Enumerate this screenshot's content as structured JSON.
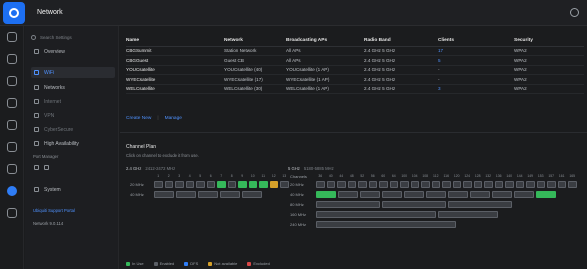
{
  "app": {
    "title": "Network"
  },
  "sidebar": {
    "search_placeholder": "Search Settings",
    "items": [
      {
        "label": "Overview"
      },
      {
        "label": "WiFi"
      },
      {
        "label": "Networks"
      },
      {
        "label": "Internet"
      },
      {
        "label": "VPN"
      },
      {
        "label": "CyberSecure"
      },
      {
        "label": "High Availability"
      }
    ],
    "section_head": "Port Manager",
    "system_label": "System",
    "support_link": "Ubiquiti Support Portal",
    "footer": "Network 9.0.114"
  },
  "table": {
    "columns": [
      "Name",
      "Network",
      "Broadcasting APs",
      "Radio Band",
      "Clients",
      "Security"
    ],
    "rows": [
      {
        "name": "CBGSummit",
        "network": "Station Network",
        "aps": "All APs",
        "band": "2.4 GHz  5 GHz",
        "clients": "17",
        "security": "WPA2"
      },
      {
        "name": "CBGGuest",
        "network": "Guest CB",
        "aps": "All APs",
        "band": "2.4 GHz  5 GHz",
        "clients": "5",
        "security": "WPA2"
      },
      {
        "name": "YOUCsatellite",
        "network": "YOUCsatellite (40)",
        "aps": "YOUCsatellite (1 AP)",
        "band": "2.4 GHz  5 GHz",
        "clients": "-",
        "security": "WPA2"
      },
      {
        "name": "WYECsatellite",
        "network": "WYECsatellite (17)",
        "aps": "WYECsatellite (1 AP)",
        "band": "2.4 GHz  5 GHz",
        "clients": "-",
        "security": "WPA2"
      },
      {
        "name": "WELCsatellite",
        "network": "WELCsatellite (30)",
        "aps": "WELCsatellite (1 AP)",
        "band": "2.4 GHz  5 GHz",
        "clients": "3",
        "security": "WPA2"
      }
    ],
    "actions": {
      "create": "Create New",
      "manage": "Manage"
    }
  },
  "channel_plan": {
    "title": "Channel Plan",
    "subtitle": "Click on channel to exclude it from use.",
    "band24": {
      "label": "2.4 GHz",
      "range": "2412-2472 MHz",
      "rows": [
        "20 MHz",
        "40 MHz"
      ]
    },
    "band5": {
      "label": "5 GHz",
      "range": "5180-5885 MHz",
      "rows": [
        "Channels",
        "20 MHz",
        "40 MHz",
        "80 MHz",
        "160 MHz",
        "240 MHz"
      ]
    },
    "legend": [
      "In Use",
      "Enabled",
      "DFS",
      "Not available",
      "Excluded"
    ],
    "legend_colors": {
      "in_use": "#35b85a",
      "enabled": "#5b5f66",
      "dfs": "#2f7df6",
      "not_available": "#d5a02a",
      "excluded": "#d94848"
    }
  }
}
